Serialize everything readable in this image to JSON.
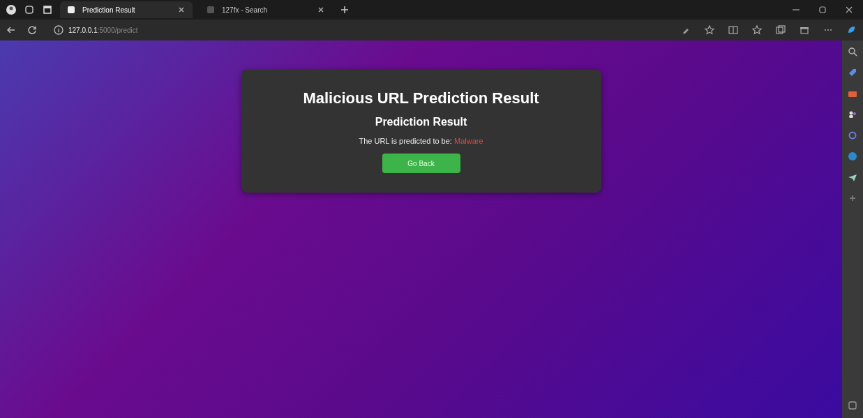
{
  "tabs": [
    {
      "title": "Prediction Result",
      "selected": true
    },
    {
      "title": "127fx - Search",
      "selected": false
    }
  ],
  "address": {
    "host": "127.0.0.1",
    "path": ":5000/predict"
  },
  "card": {
    "title": "Malicious URL Prediction Result",
    "subtitle": "Prediction Result",
    "message": "The URL is predicted to be:",
    "result": "Malware",
    "button": "Go Back"
  }
}
